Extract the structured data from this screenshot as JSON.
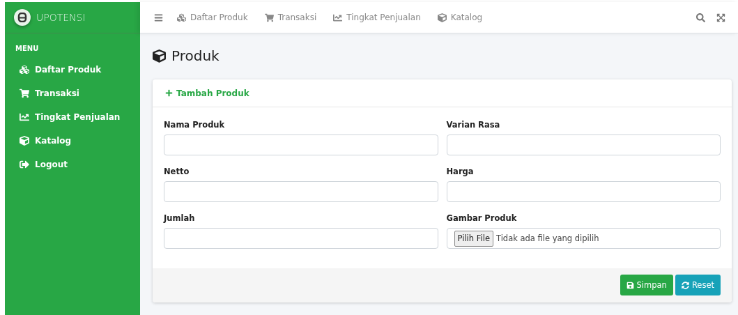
{
  "brand": {
    "name": "UPOTENSI"
  },
  "sidebar": {
    "heading": "MENU",
    "items": [
      {
        "label": "Daftar Produk"
      },
      {
        "label": "Transaksi"
      },
      {
        "label": "Tingkat Penjualan"
      },
      {
        "label": "Katalog"
      },
      {
        "label": "Logout"
      }
    ]
  },
  "navbar": {
    "items": [
      {
        "label": "Daftar Produk"
      },
      {
        "label": "Transaksi"
      },
      {
        "label": "Tingkat Penjualan"
      },
      {
        "label": "Katalog"
      }
    ]
  },
  "page_title": "Produk",
  "card": {
    "title": "Tambah Produk",
    "fields": [
      {
        "kind": "text",
        "label": "Nama Produk"
      },
      {
        "kind": "text",
        "label": "Varian Rasa"
      },
      {
        "kind": "text",
        "label": "Netto"
      },
      {
        "kind": "text",
        "label": "Harga"
      },
      {
        "kind": "text",
        "label": "Jumlah"
      },
      {
        "kind": "file",
        "label": "Gambar Produk",
        "button_label": "Pilih File",
        "status": "Tidak ada file yang dipilih"
      }
    ],
    "buttons": [
      {
        "kind": "save",
        "label": "Simpan"
      },
      {
        "kind": "reset",
        "label": "Reset"
      }
    ]
  }
}
